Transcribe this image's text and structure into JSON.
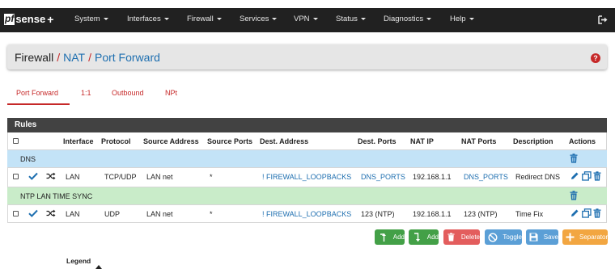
{
  "nav": {
    "logo_pf": "pf",
    "logo_sense": "sense",
    "logo_plus": "+",
    "items": [
      "System",
      "Interfaces",
      "Firewall",
      "Services",
      "VPN",
      "Status",
      "Diagnostics",
      "Help"
    ]
  },
  "breadcrumb": {
    "root": "Firewall",
    "sep": "/",
    "nat": "NAT",
    "current": "Port Forward",
    "help": "?"
  },
  "tabs": [
    "Port Forward",
    "1:1",
    "Outbound",
    "NPt"
  ],
  "rules": {
    "title": "Rules",
    "headers": [
      "Interface",
      "Protocol",
      "Source Address",
      "Source Ports",
      "Dest. Address",
      "Dest. Ports",
      "NAT IP",
      "NAT Ports",
      "Description",
      "Actions"
    ],
    "separators": [
      "DNS",
      "NTP LAN TIME SYNC"
    ],
    "rows": [
      {
        "interface": "LAN",
        "protocol": "TCP/UDP",
        "source_address": "LAN net",
        "source_ports": "*",
        "dest_address": "! FIREWALL_LOOPBACKS",
        "dest_ports": "DNS_PORTS",
        "nat_ip": "192.168.1.1",
        "nat_ports": "DNS_PORTS",
        "description": "Redirect DNS"
      },
      {
        "interface": "LAN",
        "protocol": "UDP",
        "source_address": "LAN net",
        "source_ports": "*",
        "dest_address": "! FIREWALL_LOOPBACKS",
        "dest_ports": "123 (NTP)",
        "nat_ip": "192.168.1.1",
        "nat_ports": "123 (NTP)",
        "description": "Time Fix"
      }
    ]
  },
  "buttons": {
    "add_top": "Add",
    "add_bottom": "Add",
    "delete": "Delete",
    "toggle": "Toggle",
    "save": "Save",
    "separator": "Separator"
  },
  "legend": "Legend",
  "colors": {
    "accent_red": "#c62828",
    "link_blue": "#1e6fb0",
    "dns_separator": "#c3e3f7",
    "ntp_separator": "#c9ecc9",
    "nav_bg": "#212121"
  }
}
